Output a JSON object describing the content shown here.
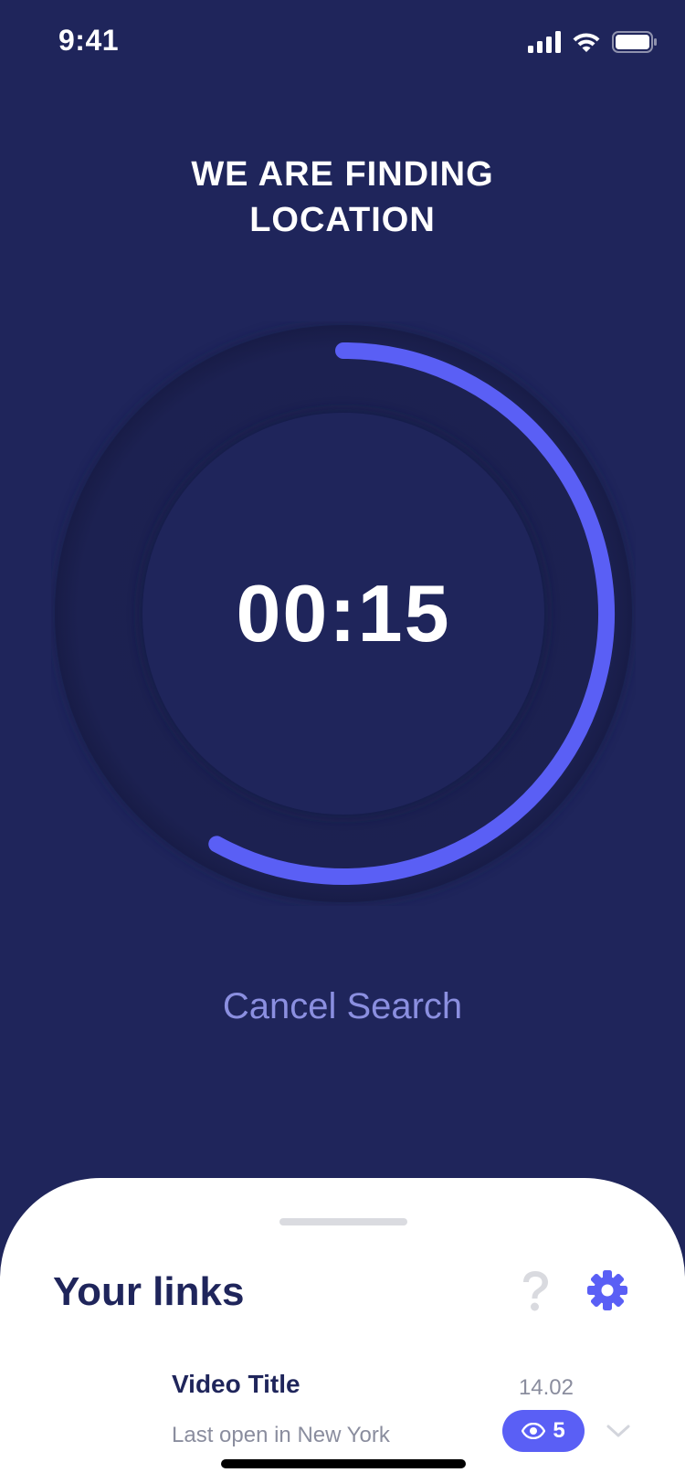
{
  "status_bar": {
    "time": "9:41",
    "icons": [
      "cellular-signal-icon",
      "wifi-icon",
      "battery-icon"
    ]
  },
  "search": {
    "title_line1": "WE ARE FINDING",
    "title_line2": "LOCATION",
    "timer": "00:15",
    "progress_fraction": 0.58,
    "cancel_label": "Cancel Search"
  },
  "sheet": {
    "title": "Your links",
    "help_icon": "question-icon",
    "settings_icon": "gear-icon",
    "links": [
      {
        "title": "Video Title",
        "date": "14.02",
        "subtitle": "Last open in New York",
        "views": "5",
        "views_icon": "eye-icon",
        "expand_icon": "chevron-down-icon"
      }
    ]
  },
  "colors": {
    "background": "#1F255B",
    "accent": "#5A5FF5",
    "cancel_text": "#8B8FE0",
    "sheet_background": "#FFFFFF",
    "muted_text": "#8A8D9E",
    "dark_text": "#1F255B"
  }
}
